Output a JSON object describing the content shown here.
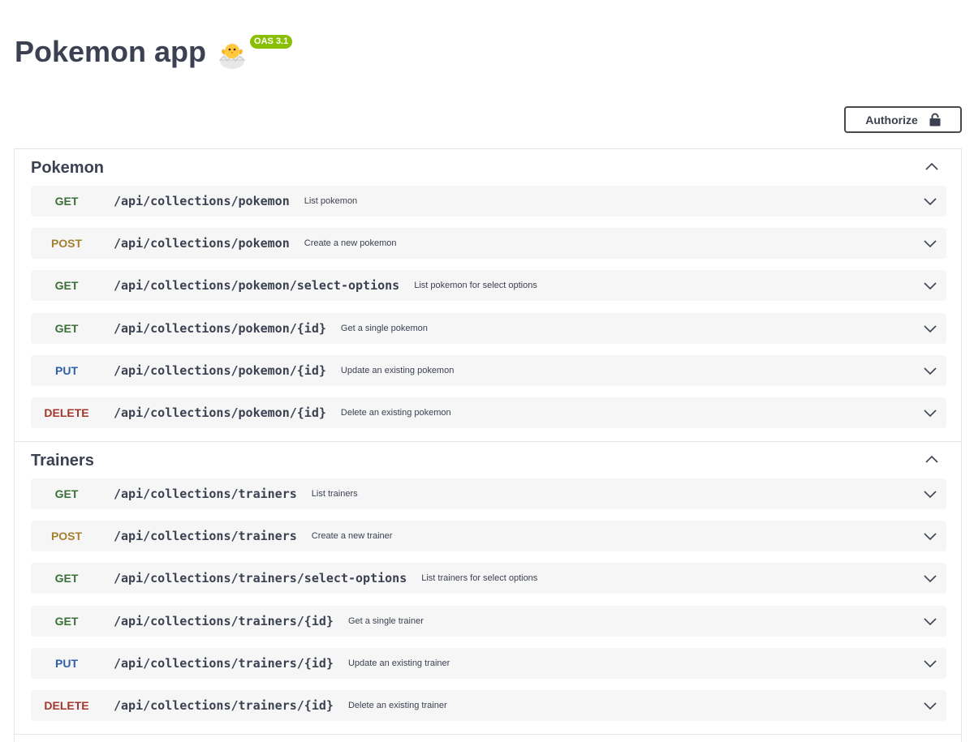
{
  "header": {
    "title": "Pokemon app",
    "version_badge": "OAS 3.1",
    "emoji_icon": "hatching-chick-icon"
  },
  "authorize": {
    "label": "Authorize",
    "icon": "lock-icon"
  },
  "colors": {
    "get": "#3a6f38",
    "post": "#a37f2f",
    "put": "#2e5fa9",
    "delete": "#a4362b",
    "badge": "#89bf04",
    "op_bg": "#f6f6f7"
  },
  "tags": [
    {
      "name": "Pokemon",
      "operations": [
        {
          "method": "GET",
          "path": "/api/collections/pokemon",
          "summary": "List pokemon"
        },
        {
          "method": "POST",
          "path": "/api/collections/pokemon",
          "summary": "Create a new pokemon"
        },
        {
          "method": "GET",
          "path": "/api/collections/pokemon/select-options",
          "summary": "List pokemon for select options"
        },
        {
          "method": "GET",
          "path": "/api/collections/pokemon/{id}",
          "summary": "Get a single pokemon"
        },
        {
          "method": "PUT",
          "path": "/api/collections/pokemon/{id}",
          "summary": "Update an existing pokemon"
        },
        {
          "method": "DELETE",
          "path": "/api/collections/pokemon/{id}",
          "summary": "Delete an existing pokemon"
        }
      ]
    },
    {
      "name": "Trainers",
      "operations": [
        {
          "method": "GET",
          "path": "/api/collections/trainers",
          "summary": "List trainers"
        },
        {
          "method": "POST",
          "path": "/api/collections/trainers",
          "summary": "Create a new trainer"
        },
        {
          "method": "GET",
          "path": "/api/collections/trainers/select-options",
          "summary": "List trainers for select options"
        },
        {
          "method": "GET",
          "path": "/api/collections/trainers/{id}",
          "summary": "Get a single trainer"
        },
        {
          "method": "PUT",
          "path": "/api/collections/trainers/{id}",
          "summary": "Update an existing trainer"
        },
        {
          "method": "DELETE",
          "path": "/api/collections/trainers/{id}",
          "summary": "Delete an existing trainer"
        }
      ]
    }
  ]
}
